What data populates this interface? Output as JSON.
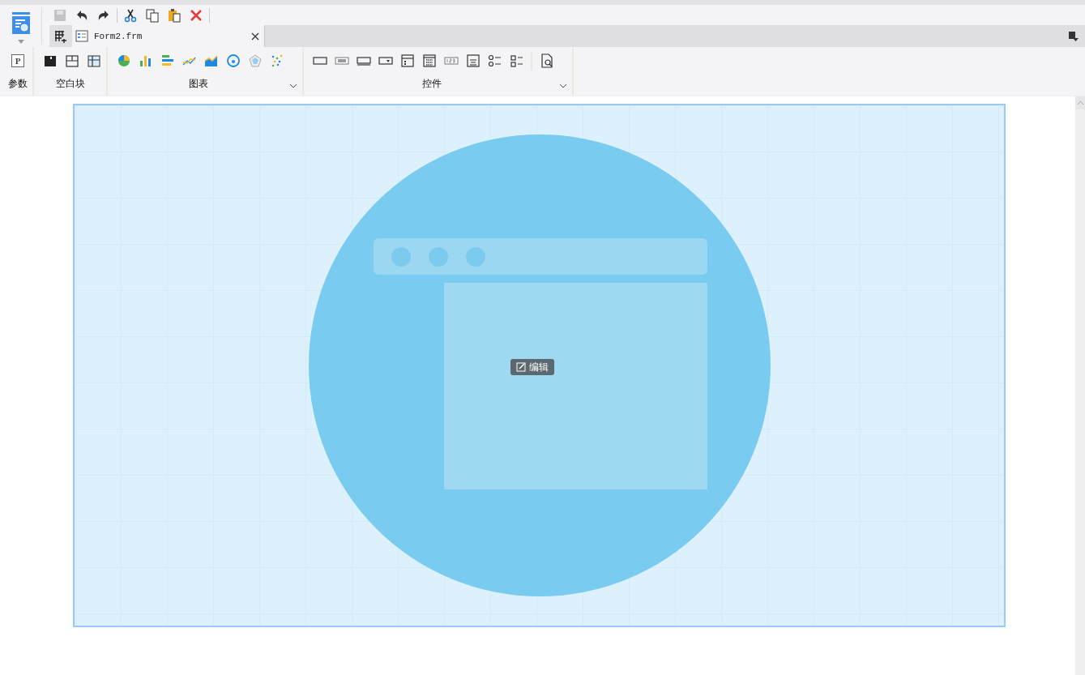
{
  "quick_toolbar": [
    {
      "kind": "save",
      "disabled": true
    },
    {
      "kind": "undo",
      "disabled": false
    },
    {
      "kind": "redo",
      "disabled": false
    },
    {
      "kind": "cut",
      "disabled": false
    },
    {
      "kind": "copy",
      "disabled": false
    },
    {
      "kind": "paste",
      "disabled": false
    },
    {
      "kind": "delete",
      "disabled": false
    }
  ],
  "tabs": [
    {
      "label": "Form2.frm",
      "selected": true
    }
  ],
  "ribbon": [
    {
      "label": "参数",
      "dropdown": false,
      "icons": [
        {
          "kind": "param",
          "glyph": "P"
        }
      ]
    },
    {
      "label": "空白块",
      "dropdown": false,
      "icons": [
        {
          "kind": "block-fill"
        },
        {
          "kind": "block-grid"
        },
        {
          "kind": "block-head"
        }
      ]
    },
    {
      "label": "图表",
      "dropdown": true,
      "icons": [
        {
          "kind": "pie"
        },
        {
          "kind": "bar"
        },
        {
          "kind": "hbar"
        },
        {
          "kind": "line"
        },
        {
          "kind": "area"
        },
        {
          "kind": "gauge"
        },
        {
          "kind": "radar"
        },
        {
          "kind": "scatter"
        }
      ]
    },
    {
      "label": "控件",
      "dropdown": true,
      "icons": [
        {
          "kind": "textbox"
        },
        {
          "kind": "label"
        },
        {
          "kind": "input"
        },
        {
          "kind": "combo"
        },
        {
          "kind": "list"
        },
        {
          "kind": "date"
        },
        {
          "kind": "number"
        },
        {
          "kind": "textarea"
        },
        {
          "kind": "radio"
        },
        {
          "kind": "check"
        },
        {
          "kind": "sep"
        },
        {
          "kind": "preview"
        }
      ]
    }
  ],
  "canvas": {
    "edit_button": "编辑"
  }
}
